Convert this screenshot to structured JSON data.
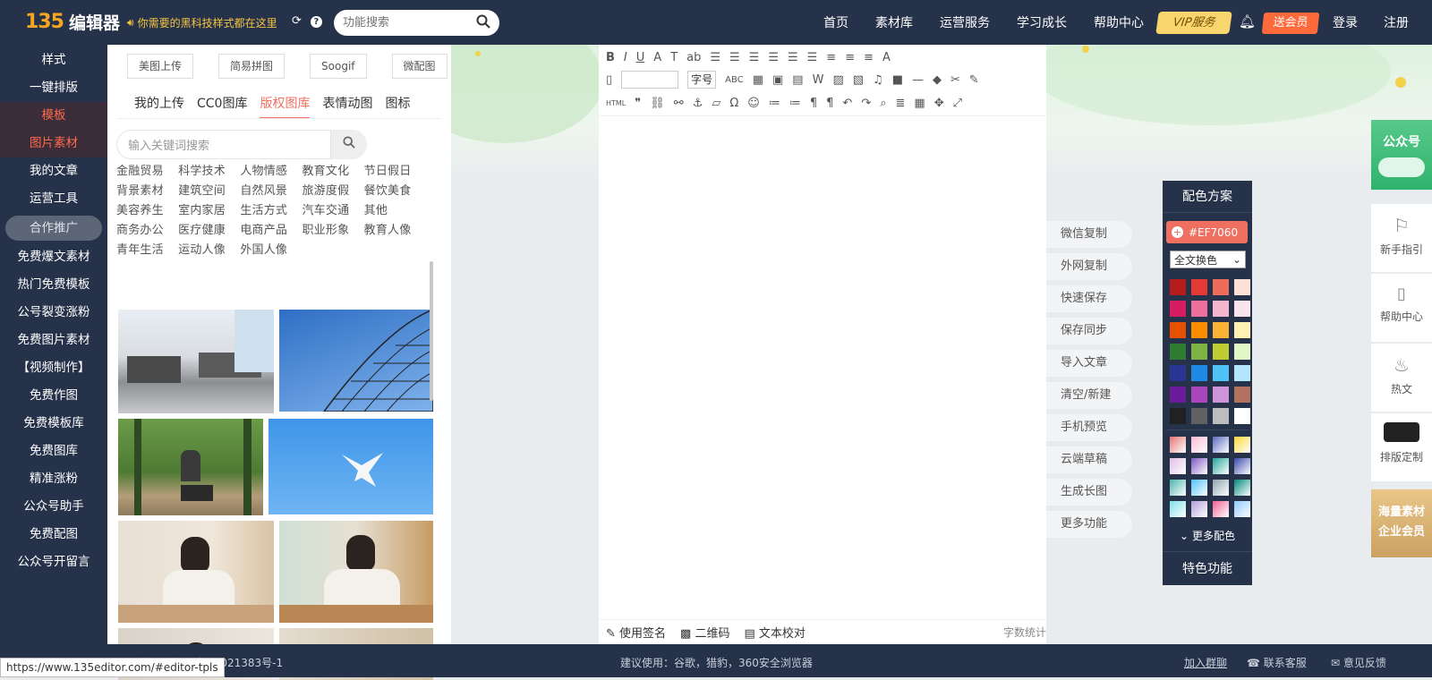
{
  "logo": {
    "mark": "135",
    "text": "编辑器"
  },
  "promo": {
    "text": "你需要的黑科技样式都在这里"
  },
  "search": {
    "placeholder": "功能搜索"
  },
  "nav": [
    "首页",
    "素材库",
    "运营服务",
    "学习成长",
    "帮助中心"
  ],
  "vip": "VIP服务",
  "member": "送会员",
  "login": "登录",
  "register": "注册",
  "sidebar": {
    "items": [
      "样式",
      "一键排版",
      "模板",
      "图片素材",
      "我的文章",
      "运营工具",
      "合作推广",
      "免费爆文素材",
      "热门免费模板",
      "公号裂变涨粉",
      "免费图片素材",
      "【视频制作】",
      "免费作图",
      "免费模板库",
      "免费图库",
      "精准涨粉",
      "公众号助手",
      "免费配图",
      "公众号开留言"
    ]
  },
  "panel": {
    "top_buttons": [
      "美图上传",
      "简易拼图",
      "Soogif",
      "微配图"
    ],
    "tabs": [
      "我的上传",
      "CC0图库",
      "版权图库",
      "表情动图",
      "图标"
    ],
    "active_tab": "版权图库",
    "keyword_placeholder": "输入关键词搜索",
    "categories": [
      "金融贸易",
      "科学技术",
      "人物情感",
      "教育文化",
      "节日假日",
      "背景素材",
      "建筑空间",
      "自然风景",
      "旅游度假",
      "餐饮美食",
      "美容养生",
      "室内家居",
      "生活方式",
      "汽车交通",
      "其他",
      "商务办公",
      "医疗健康",
      "电商产品",
      "职业形象",
      "教育人像",
      "青年生活",
      "运动人像",
      "外国人像"
    ]
  },
  "toolbar": {
    "fontsize_label": "字号"
  },
  "editor_footer": {
    "signature": "使用签名",
    "qrcode": "二维码",
    "proofread": "文本校对",
    "wordcount": "字数统计"
  },
  "actions": [
    "微信复制",
    "外网复制",
    "快速保存",
    "保存同步",
    "导入文章",
    "清空/新建",
    "手机预览",
    "云端草稿",
    "生成长图",
    "更多功能"
  ],
  "scheme": {
    "title": "配色方案",
    "hex": "#EF7060",
    "mode": "全文换色",
    "more": "更多配色",
    "feature": "特色功能",
    "colors": [
      "#b71c1c",
      "#e53935",
      "#ef6c5a",
      "#fde0d6",
      "#d81b60",
      "#ec6f9c",
      "#f4b6cf",
      "#fce4ec",
      "#e65100",
      "#fb8c00",
      "#f9b233",
      "#fff2b3",
      "#2e7d32",
      "#7cb342",
      "#c0ca33",
      "#e3f6c5",
      "#283593",
      "#1e88e5",
      "#4fc3f7",
      "#b3e5fc",
      "#6a1b9a",
      "#ab47bc",
      "#ce93d8",
      "#b57160",
      "#212121",
      "#616161",
      "#bdbdbd",
      "#ffffff"
    ],
    "gradients": [
      "#e57373",
      "#f8bbd0",
      "#5c6bc0",
      "#fdd835",
      "#e1bee7",
      "#7e57c2",
      "#26a69a",
      "#3949ab",
      "#4db6ac",
      "#4fc3f7",
      "#90a4ae",
      "#00897b",
      "#80deea",
      "#b39ddb",
      "#f06292",
      "#90caf9"
    ]
  },
  "right_sidebar": {
    "gzh": "公众号",
    "items": [
      "新手指引",
      "帮助中心",
      "热文",
      "排版定制"
    ],
    "enterprise": [
      "海量素材",
      "企业会员"
    ]
  },
  "footer": {
    "left": "© Powered by 135编辑器 京ICP备14021383号-1",
    "center": "建议使用：谷歌，猎豹，360安全浏览器",
    "links": [
      "加入群聊",
      "联系客服",
      "意见反馈"
    ]
  },
  "status_url": "https://www.135editor.com/#editor-tpls"
}
